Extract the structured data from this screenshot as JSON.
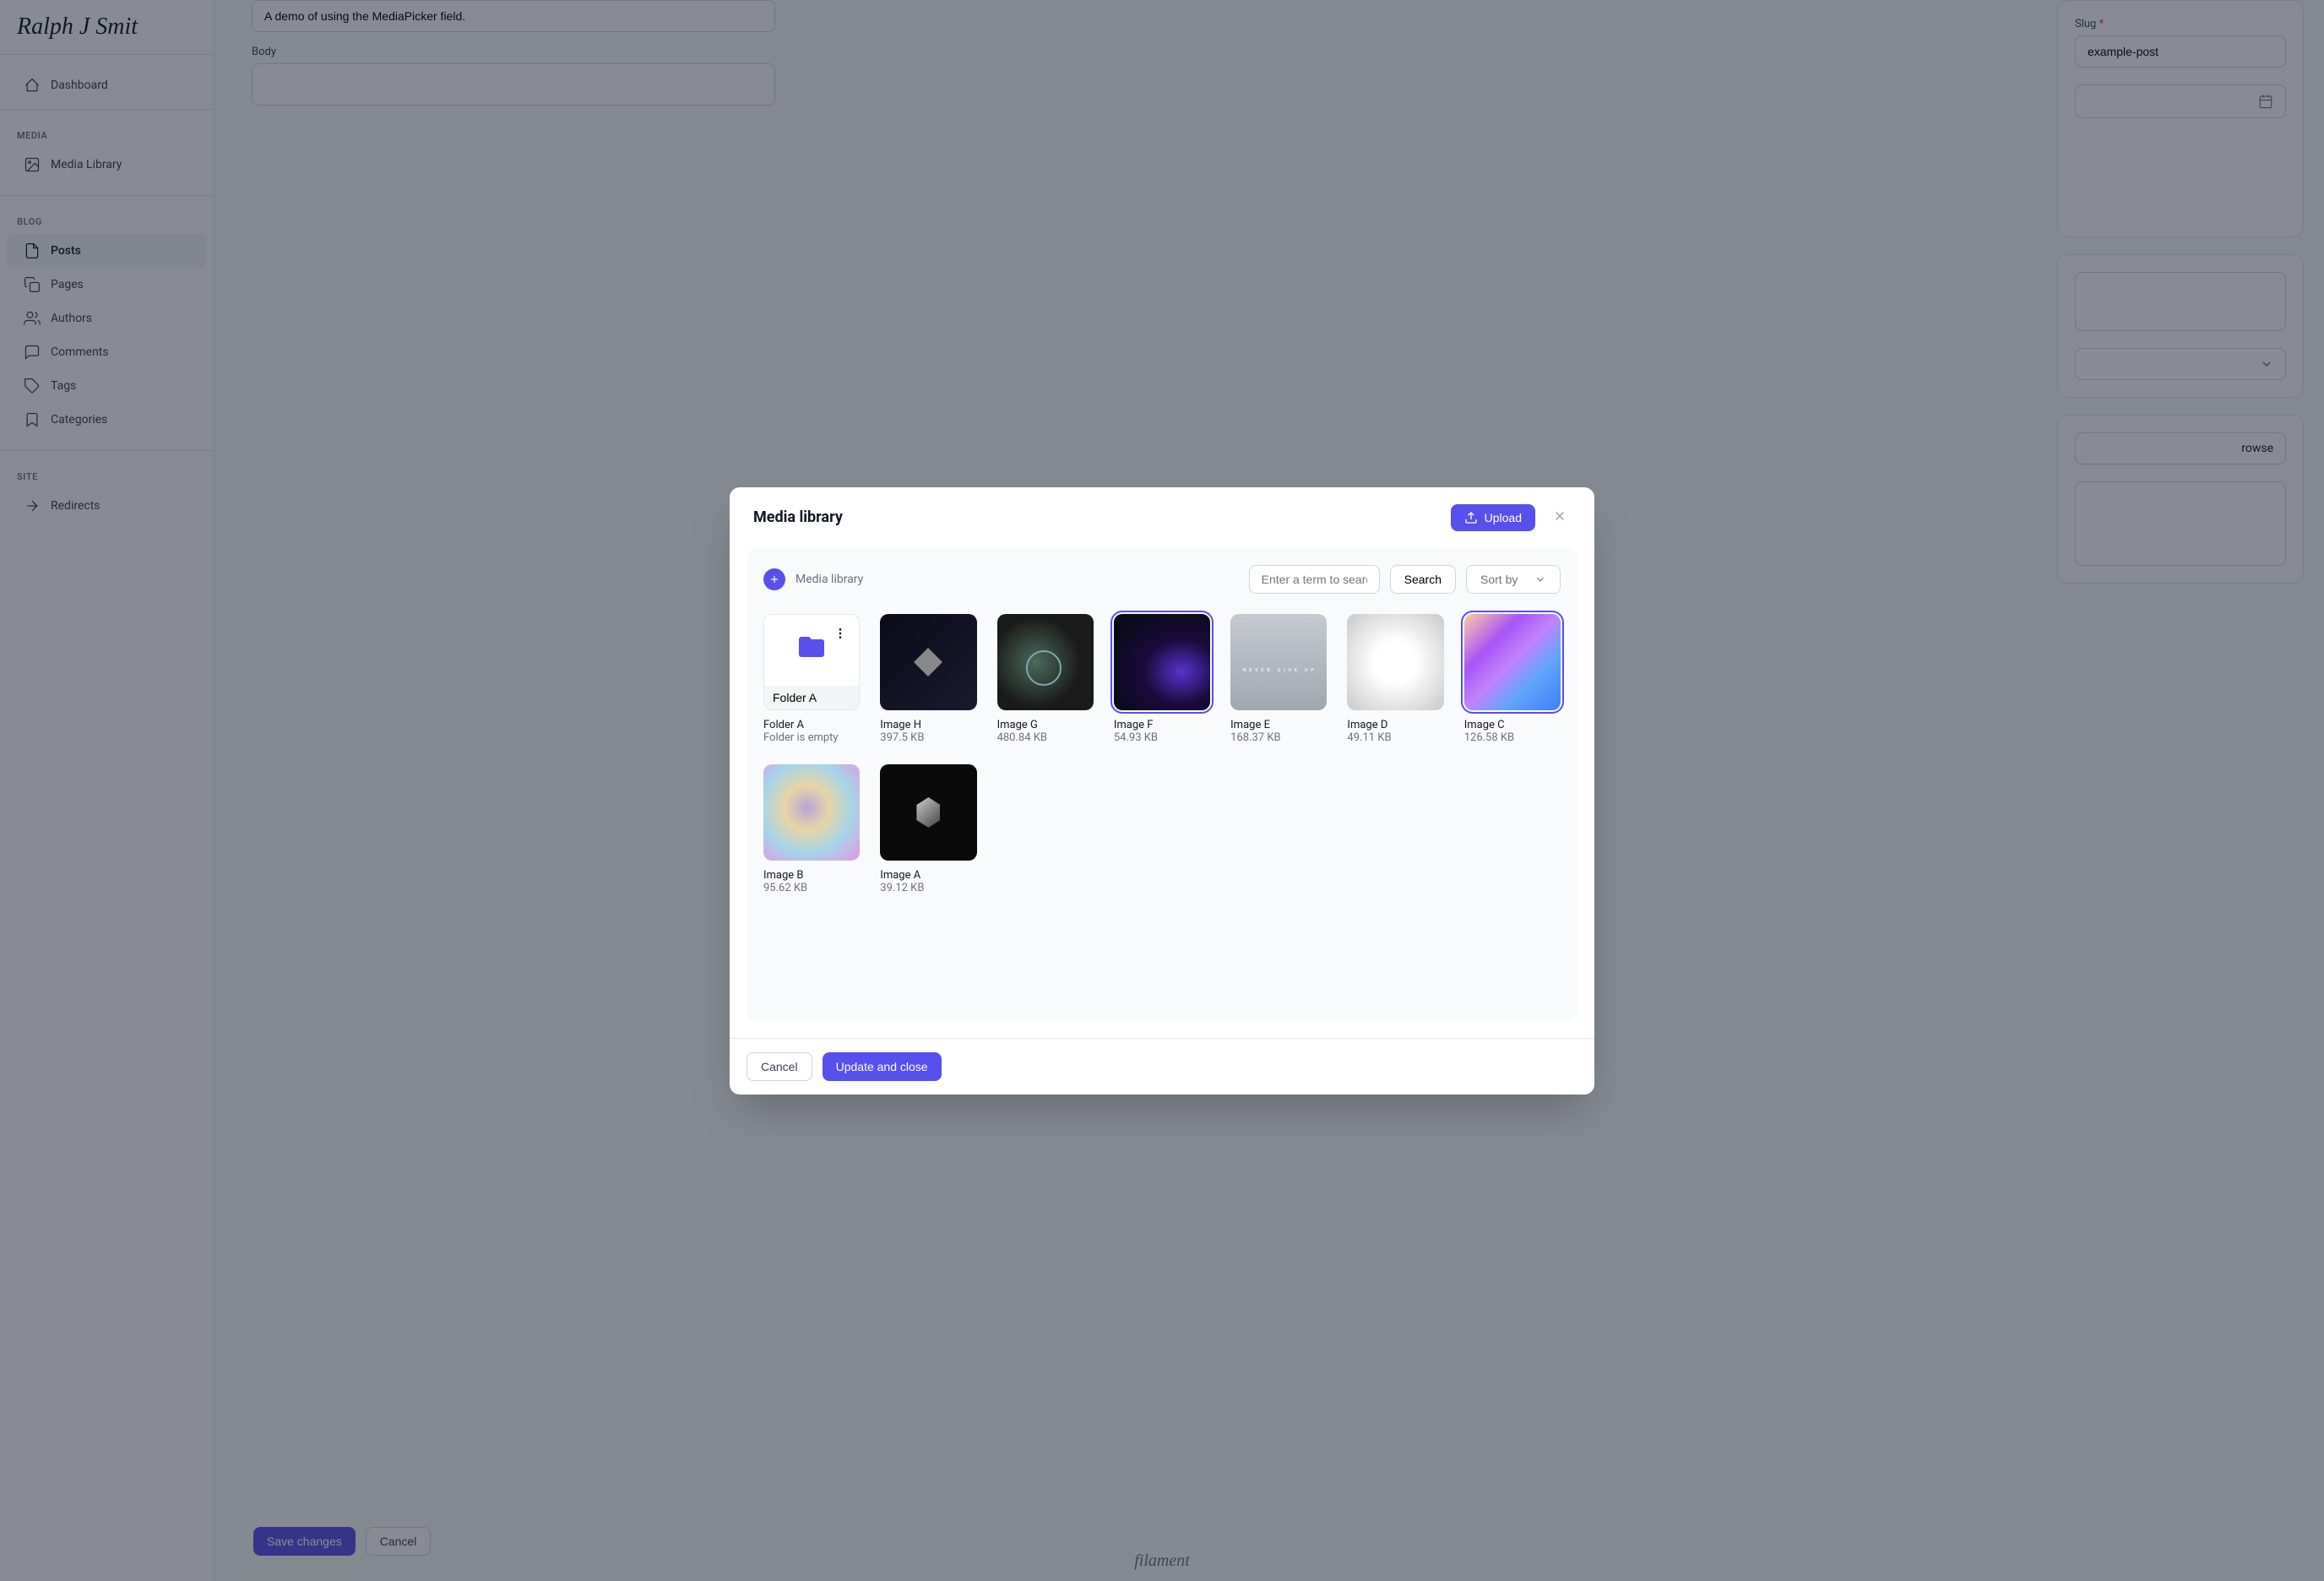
{
  "brand": "Ralph J Smit",
  "sidebar": {
    "dashboard": "Dashboard",
    "sections": {
      "media": {
        "header": "MEDIA",
        "library": "Media Library"
      },
      "blog": {
        "header": "BLOG",
        "posts": "Posts",
        "pages": "Pages",
        "authors": "Authors",
        "comments": "Comments",
        "tags": "Tags",
        "categories": "Categories"
      },
      "site": {
        "header": "SITE",
        "redirects": "Redirects"
      }
    }
  },
  "page": {
    "demo_text": "A demo of using the MediaPicker field.",
    "body_label": "Body",
    "slug_label": "Slug",
    "slug_value": "example-post",
    "browse_text": "rowse",
    "save_btn": "Save changes",
    "cancel_btn": "Cancel",
    "footer": "filament"
  },
  "modal": {
    "title": "Media library",
    "upload_btn": "Upload",
    "breadcrumb": "Media library",
    "search_placeholder": "Enter a term to search",
    "search_btn": "Search",
    "sort_btn": "Sort by",
    "folder_edit_value": "Folder A",
    "items": [
      {
        "type": "folder",
        "name": "Folder A",
        "meta": "Folder is empty"
      },
      {
        "type": "image",
        "name": "Image H",
        "meta": "397.5 KB",
        "thumb": "h",
        "selected": false
      },
      {
        "type": "image",
        "name": "Image G",
        "meta": "480.84 KB",
        "thumb": "g",
        "selected": false
      },
      {
        "type": "image",
        "name": "Image F",
        "meta": "54.93 KB",
        "thumb": "f",
        "selected": true
      },
      {
        "type": "image",
        "name": "Image E",
        "meta": "168.37 KB",
        "thumb": "e",
        "selected": false
      },
      {
        "type": "image",
        "name": "Image D",
        "meta": "49.11 KB",
        "thumb": "d",
        "selected": false
      },
      {
        "type": "image",
        "name": "Image C",
        "meta": "126.58 KB",
        "thumb": "c",
        "selected": true
      },
      {
        "type": "image",
        "name": "Image B",
        "meta": "95.62 KB",
        "thumb": "b",
        "selected": false
      },
      {
        "type": "image",
        "name": "Image A",
        "meta": "39.12 KB",
        "thumb": "a",
        "selected": false
      }
    ],
    "cancel_btn": "Cancel",
    "update_btn": "Update and close"
  }
}
